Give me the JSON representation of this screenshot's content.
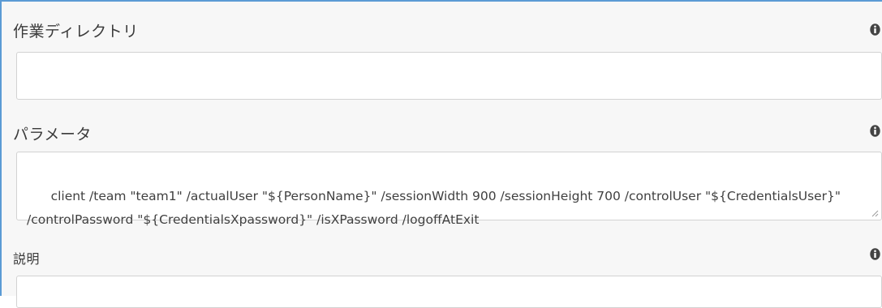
{
  "fields": {
    "working_directory": {
      "label": "作業ディレクトリ",
      "value": ""
    },
    "parameters": {
      "label": "パラメータ",
      "value": "client /team \"team1\" /actualUser \"${PersonName}\" /sessionWidth 900 /sessionHeight 700 /controlUser \"${CredentialsUser}\" /controlPassword \"${CredentialsXpassword}\" /isXPassword /logoffAtExit"
    },
    "description": {
      "label": "説明",
      "value": ""
    }
  },
  "icons": {
    "info": "info-icon",
    "resize": "resize-grip-icon"
  },
  "colors": {
    "accent_border": "#5b9bd5",
    "panel_background": "#f7f7f7",
    "input_border": "#d2d2d2",
    "text": "#3a3a3a"
  }
}
